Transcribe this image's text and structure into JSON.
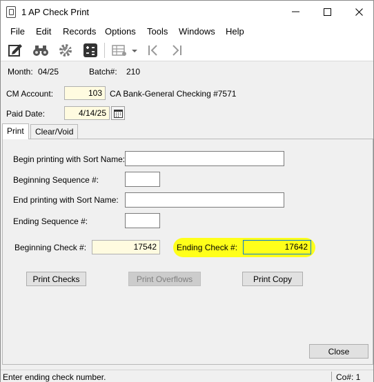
{
  "window": {
    "title": "1 AP Check Print"
  },
  "menu": [
    "File",
    "Edit",
    "Records",
    "Options",
    "Tools",
    "Windows",
    "Help"
  ],
  "header": {
    "month_label": "Month:",
    "month_value": "04/25",
    "batch_label": "Batch#:",
    "batch_value": "210"
  },
  "cm_account": {
    "label": "CM Account:",
    "value": "103",
    "description": "CA Bank-General Checking #7571"
  },
  "paid_date": {
    "label": "Paid Date:",
    "value": "4/14/25"
  },
  "tabs": [
    {
      "label": "Print",
      "active": true
    },
    {
      "label": "Clear/Void",
      "active": false
    }
  ],
  "print_form": {
    "begin_sort_label": "Begin printing with Sort Name:",
    "begin_seq_label": "Beginning Sequence #:",
    "end_sort_label": "End printing with Sort Name:",
    "end_seq_label": "Ending Sequence #:",
    "begin_check_label": "Beginning Check #:",
    "begin_check_value": "17542",
    "end_check_label": "Ending Check #:",
    "end_check_value": "17642"
  },
  "buttons": {
    "print_checks": "Print Checks",
    "print_overflows": "Print Overflows",
    "print_copy": "Print Copy",
    "close": "Close"
  },
  "status": {
    "message": "Enter ending check number.",
    "company": "Co#: 1"
  },
  "colors": {
    "highlight": "#ffff1a",
    "field_yellow": "#fffbe0",
    "focus_border": "#0078d7"
  }
}
